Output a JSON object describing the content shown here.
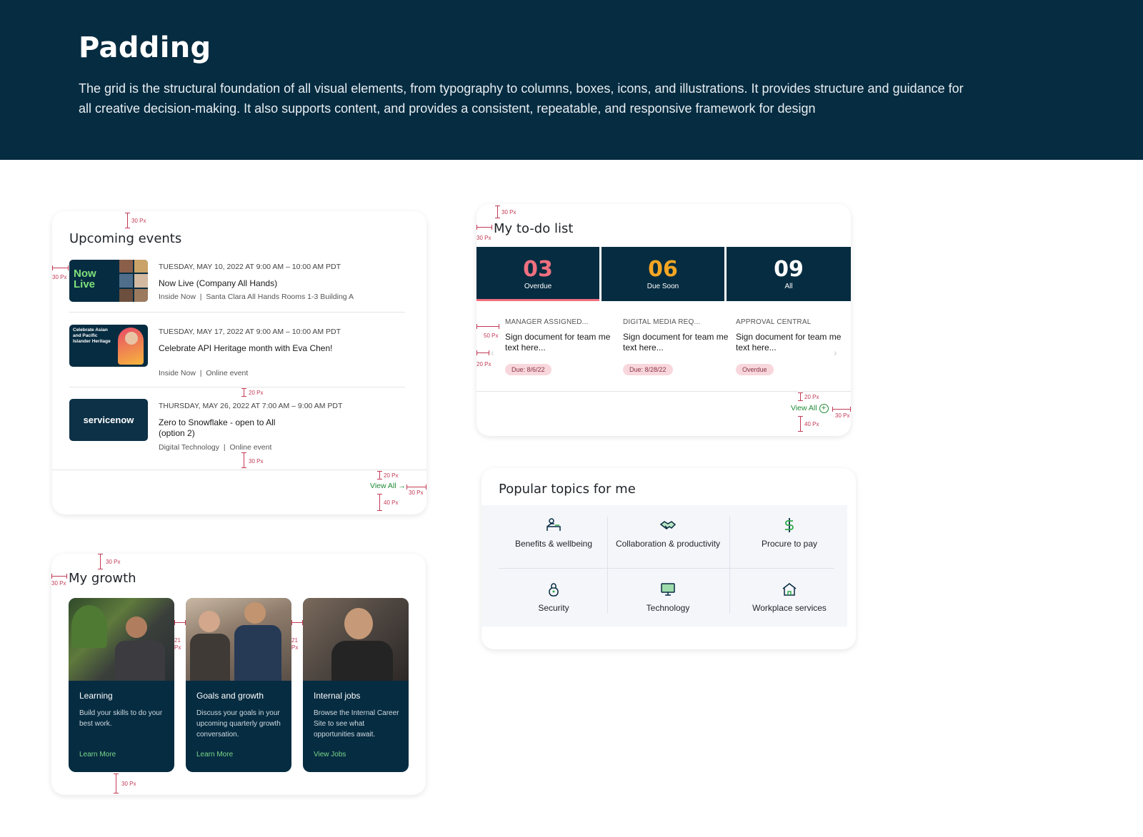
{
  "header": {
    "title": "Padding",
    "description": "The grid is the structural foundation of all visual elements, from typography to columns, boxes, icons, and illustrations. It provides structure and guidance for all creative decision-making. It also supports content, and provides a consistent, repeatable, and responsive framework for design"
  },
  "events": {
    "title": "Upcoming events",
    "view_all": "View All",
    "items": [
      {
        "date": "TUESDAY, MAY 10, 2022 AT 9:00 AM – 10:00 AM PDT",
        "name": "Now Live (Company All Hands)",
        "org": "Inside Now",
        "location": "Santa Clara All Hands Rooms 1-3 Building A",
        "thumb_text": "Now Live"
      },
      {
        "date": "TUESDAY, MAY 17, 2022 AT 9:00 AM – 10:00 AM PDT",
        "name": "Celebrate API Heritage month with Eva Chen!",
        "org": "Inside Now",
        "location": "Online event",
        "thumb_text": "Celebrate Asian and Pacific Islander Heritage"
      },
      {
        "date": "THURSDAY, MAY 26, 2022 AT 7:00 AM – 9:00 AM PDT",
        "name": "Zero to Snowflake - open to All (option 2)",
        "org": "Digital Technology",
        "location": "Online event",
        "thumb_text": "servicenow"
      }
    ]
  },
  "todo": {
    "title": "My to-do list",
    "view_all": "View All",
    "stats": [
      {
        "value": "03",
        "label": "Overdue",
        "color": "#f0707f"
      },
      {
        "value": "06",
        "label": "Due Soon",
        "color": "#f5a623"
      },
      {
        "value": "09",
        "label": "All",
        "color": "#ffffff"
      }
    ],
    "tasks": [
      {
        "category": "MANAGER ASSIGNED...",
        "desc": "Sign document for team me text here...",
        "badge": "Due: 8/6/22"
      },
      {
        "category": "DIGITAL MEDIA REQ...",
        "desc": "Sign document for team me text here...",
        "badge": "Due: 8/28/22"
      },
      {
        "category": "APPROVAL CENTRAL",
        "desc": "Sign document for team me text here...",
        "badge": "Overdue"
      }
    ]
  },
  "topics": {
    "title": "Popular topics for me",
    "items": [
      {
        "label": "Benefits & wellbeing",
        "icon": "person-bed-icon"
      },
      {
        "label": "Collaboration & productivity",
        "icon": "handshake-icon"
      },
      {
        "label": "Procure to pay",
        "icon": "dollar-icon"
      },
      {
        "label": "Security",
        "icon": "lock-icon"
      },
      {
        "label": "Technology",
        "icon": "monitor-icon"
      },
      {
        "label": "Workplace services",
        "icon": "house-icon"
      }
    ]
  },
  "growth": {
    "title": "My growth",
    "cards": [
      {
        "title": "Learning",
        "desc": "Build your skills to do your best work.",
        "link": "Learn More"
      },
      {
        "title": "Goals and growth",
        "desc": "Discuss your goals in your upcoming quarterly growth conversation.",
        "link": "Learn More"
      },
      {
        "title": "Internal jobs",
        "desc": "Browse the Internal Career Site to see what opportunities await.",
        "link": "View Jobs"
      }
    ]
  },
  "annotations": {
    "px30": "30 Px",
    "px20": "20 Px",
    "px40": "40 Px",
    "px50": "50 Px",
    "px21": "21 Px"
  }
}
